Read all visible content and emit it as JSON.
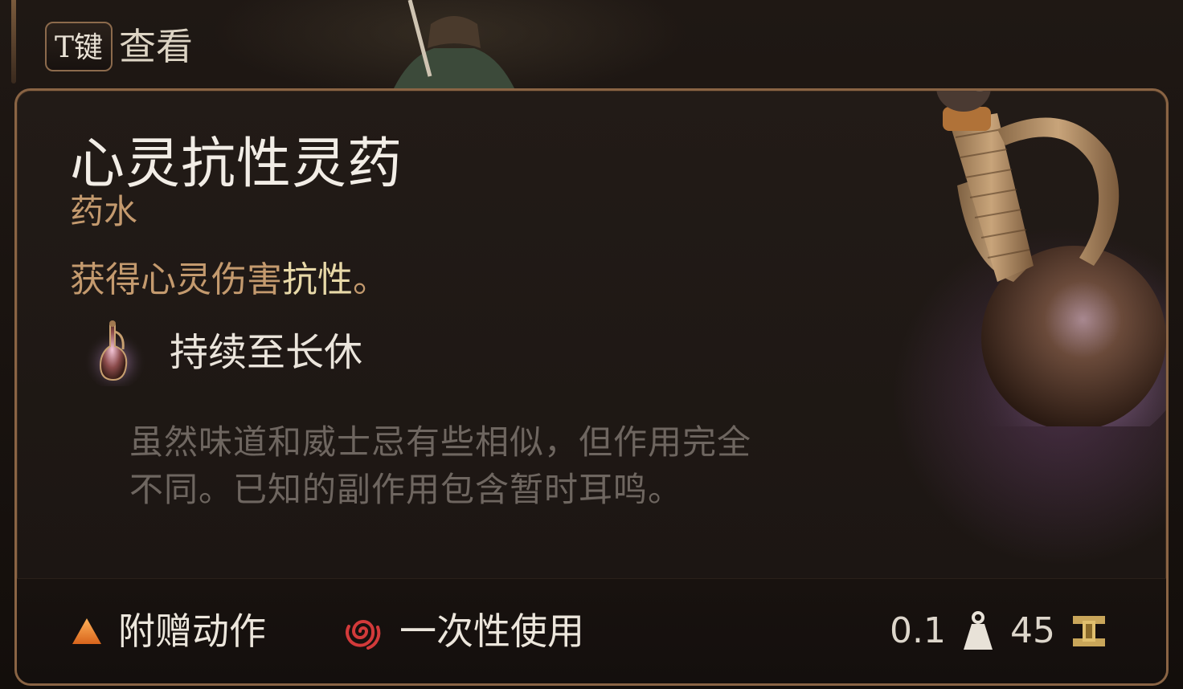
{
  "hint": {
    "key": "T键",
    "label": "查看"
  },
  "item": {
    "name": "心灵抗性灵药",
    "type": "药水",
    "effect_prefix": "获得心灵伤害",
    "effect_highlight": "抗性",
    "effect_suffix": "。",
    "duration": "持续至长休",
    "flavor": "虽然味道和威士忌有些相似，但作用完全不同。已知的副作用包含暂时耳鸣。"
  },
  "footer": {
    "action_type": "附赠动作",
    "usage": "一次性使用",
    "weight": "0.1",
    "value": "45"
  },
  "icons": {
    "action": "triangle-icon",
    "usage": "swirl-icon",
    "weight": "weight-icon",
    "value": "gold-coin-icon",
    "duration": "potion-icon"
  },
  "colors": {
    "border": "#8a6444",
    "subtype": "#c49a6e",
    "highlight": "#e8d9a8",
    "action": "#f08a2a",
    "usage": "#d23a3a"
  }
}
